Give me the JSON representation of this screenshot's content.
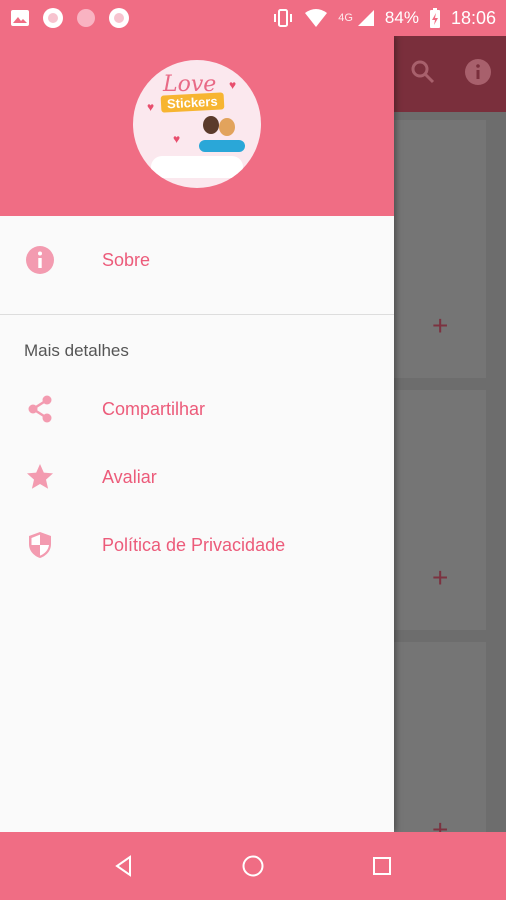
{
  "status_bar": {
    "network": "4G",
    "battery": "84%",
    "time": "18:06",
    "icons": [
      "image-icon",
      "app-circle-icon",
      "app-circle-icon",
      "app-circle-icon",
      "vibrate-icon",
      "wifi-icon",
      "signal-icon",
      "battery-charging-icon"
    ]
  },
  "colors": {
    "accent": "#f06d84",
    "label": "#ec5b7a",
    "icon": "#f39bb0"
  },
  "drawer": {
    "logo": {
      "line1": "Love",
      "line2": "Stickers"
    },
    "items": [
      {
        "label": "Sobre",
        "icon": "info-icon"
      }
    ],
    "section_title": "Mais detalhes",
    "section_items": [
      {
        "label": "Compartilhar",
        "icon": "share-icon"
      },
      {
        "label": "Avaliar",
        "icon": "star-icon"
      },
      {
        "label": "Política de Privacidade",
        "icon": "shield-icon"
      }
    ]
  },
  "background_app": {
    "toolbar_icons": [
      "search-icon",
      "info-icon"
    ],
    "card_action": "+"
  },
  "nav_bar": {
    "buttons": [
      "back-icon",
      "home-icon",
      "recents-icon"
    ]
  }
}
